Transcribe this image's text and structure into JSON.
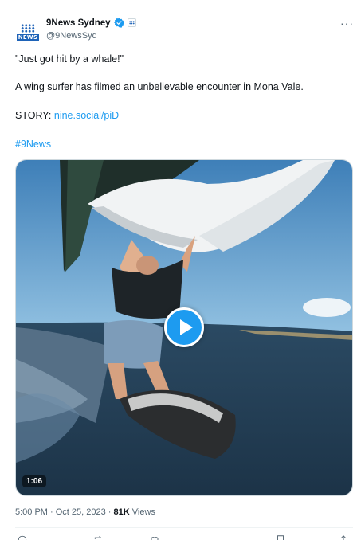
{
  "account": {
    "display_name": "9News Sydney",
    "handle": "@9NewsSyd",
    "avatar_text": "NEWS"
  },
  "tweet": {
    "lines": [
      "\"Just got hit by a whale!\"",
      "A wing surfer has filmed an unbelievable encounter in Mona Vale."
    ],
    "story_prefix": "STORY: ",
    "story_link": "nine.social/piD",
    "hashtag": "#9News"
  },
  "video": {
    "duration": "1:06"
  },
  "meta": {
    "time_date": "5:00 PM · Oct 25, 2023 · ",
    "views_count": "81K",
    "views_label": " Views"
  },
  "colors": {
    "link": "#1d9bf0",
    "muted": "#536471",
    "brand_blue": "#1e63b8"
  }
}
